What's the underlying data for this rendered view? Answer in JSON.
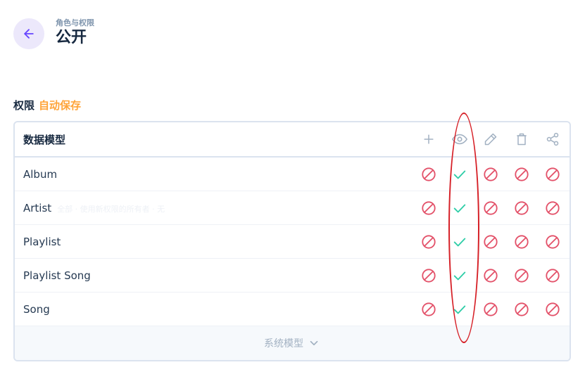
{
  "header": {
    "breadcrumb": "角色与权限",
    "title": "公开"
  },
  "section": {
    "label": "权限",
    "autosave": "自动保存"
  },
  "table": {
    "header_label": "数据模型",
    "header_icons": [
      "plus-icon",
      "eye-icon",
      "pencil-icon",
      "trash-icon",
      "share-icon"
    ],
    "rows": [
      {
        "label": "Album",
        "hint": "",
        "perms": [
          "denied",
          "allowed",
          "denied",
          "denied",
          "denied"
        ]
      },
      {
        "label": "Artist",
        "hint": "全部 · 使用新权限的所有者 · 无",
        "perms": [
          "denied",
          "allowed",
          "denied",
          "denied",
          "denied"
        ]
      },
      {
        "label": "Playlist",
        "hint": "",
        "perms": [
          "denied",
          "allowed",
          "denied",
          "denied",
          "denied"
        ]
      },
      {
        "label": "Playlist Song",
        "hint": "",
        "perms": [
          "denied",
          "allowed",
          "denied",
          "denied",
          "denied"
        ]
      },
      {
        "label": "Song",
        "hint": "",
        "perms": [
          "denied",
          "allowed",
          "denied",
          "denied",
          "denied"
        ]
      }
    ],
    "footer_label": "系统模型"
  },
  "colors": {
    "accent": "#6644ff",
    "autosave": "#ffa439",
    "denied": "#e35169",
    "allowed": "#2ecda7",
    "annotation": "#d61f26"
  }
}
